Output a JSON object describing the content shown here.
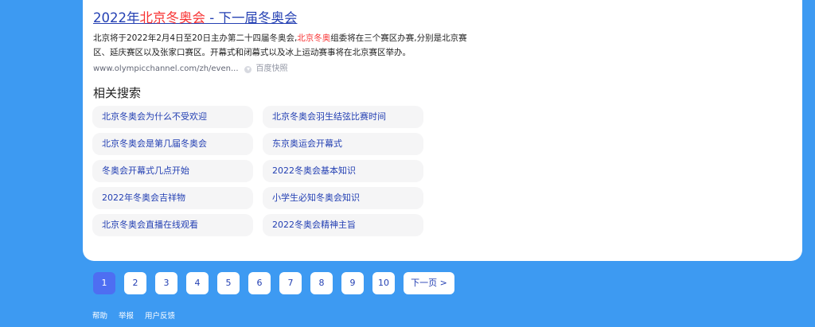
{
  "result": {
    "title_pre": "2022年",
    "title_hl": "北京冬奥会",
    "title_post": " - 下一届冬奥会",
    "abstract_pre": "北京将于2022年2月4日至20日主办第二十四届冬奥会,",
    "abstract_hl": "北京冬奥",
    "abstract_post": "组委将在三个赛区办赛,分别是北京赛区、延庆赛区以及张家口赛区。开幕式和闭幕式以及冰上运动赛事将在北京赛区举办。",
    "url": "www.olympicchannel.com/zh/even...",
    "snapshot": "百度快照"
  },
  "related": {
    "title": "相关搜索",
    "items": [
      "北京冬奥会为什么不受欢迎",
      "北京冬奥会羽生结弦比赛时间",
      "北京冬奥会是第几届冬奥会",
      "东京奥运会开幕式",
      "冬奥会开幕式几点开始",
      "2022冬奥会基本知识",
      "2022年冬奥会吉祥物",
      "小学生必知冬奥会知识",
      "北京冬奥会直播在线观看",
      "2022冬奥会精神主旨"
    ]
  },
  "pagination": {
    "current": "1",
    "pages": [
      "1",
      "2",
      "3",
      "4",
      "5",
      "6",
      "7",
      "8",
      "9",
      "10"
    ],
    "next_label": "下一页 >"
  },
  "footer": {
    "help": "帮助",
    "report": "举报",
    "feedback": "用户反馈"
  }
}
